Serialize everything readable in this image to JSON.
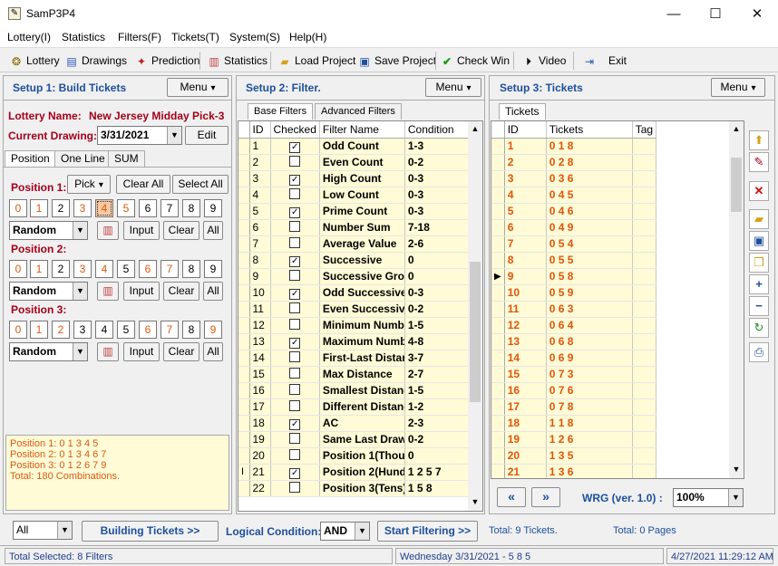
{
  "window": {
    "title": "SamP3P4",
    "minimize": "—",
    "maximize": "☐",
    "close": "✕"
  },
  "menu": [
    "Lottery(I)",
    "Statistics",
    "Filters(F)",
    "Tickets(T)",
    "System(S)",
    "Help(H)"
  ],
  "toolbar": [
    {
      "label": "Lottery",
      "icon": "lottery-icon"
    },
    {
      "label": "Drawings",
      "icon": "drawings-icon"
    },
    {
      "label": "Prediction",
      "icon": "prediction-icon"
    },
    {
      "label": "Statistics",
      "icon": "statistics-icon"
    },
    {
      "label": "Load Project",
      "icon": "folder-icon"
    },
    {
      "label": "Save Project",
      "icon": "save-icon"
    },
    {
      "label": "Check Win",
      "icon": "check-icon"
    },
    {
      "label": "Video",
      "icon": "video-icon"
    },
    {
      "label": "Exit",
      "icon": "exit-icon"
    }
  ],
  "setup1": {
    "title": "Setup 1:  Build  Tickets",
    "menu": "Menu",
    "lottery_label": "Lottery  Name:",
    "lottery_name": "New Jersey Midday Pick-3",
    "drawing_label": "Current Drawing:",
    "drawing_value": "3/31/2021",
    "edit": "Edit",
    "tabs": [
      "Position",
      "One Line",
      "SUM"
    ],
    "pick": "Pick",
    "clear_all": "Clear All",
    "select_all": "Select All",
    "positions": [
      {
        "label": "Position 1:",
        "digits": [
          "0",
          "1",
          "2",
          "3",
          "4",
          "5",
          "6",
          "7",
          "8",
          "9"
        ],
        "mode": "Random"
      },
      {
        "label": "Position 2:",
        "digits": [
          "0",
          "1",
          "2",
          "3",
          "4",
          "5",
          "6",
          "7",
          "8",
          "9"
        ],
        "mode": "Random"
      },
      {
        "label": "Position 3:",
        "digits": [
          "0",
          "1",
          "2",
          "3",
          "4",
          "5",
          "6",
          "7",
          "8",
          "9"
        ],
        "mode": "Random"
      }
    ],
    "input": "Input",
    "clear": "Clear",
    "all": "All",
    "summary": [
      "Position 1:  0 1 3 4 5",
      "Position 2:  0 1 3 4 6 7",
      "Position 3:  0 1 2 6 7 9",
      "Total: 180 Combinations."
    ]
  },
  "setup2": {
    "title": "Setup 2:  Filter.",
    "menu": "Menu",
    "tabs": [
      "Base Filters",
      "Advanced Filters"
    ],
    "columns": [
      "ID",
      "Checked",
      "Filter Name",
      "Condition"
    ],
    "rows": [
      [
        "1",
        true,
        "Odd Count",
        "1-3"
      ],
      [
        "2",
        false,
        "Even Count",
        "0-2"
      ],
      [
        "3",
        true,
        "High Count",
        "0-3"
      ],
      [
        "4",
        false,
        "Low Count",
        "0-3"
      ],
      [
        "5",
        true,
        "Prime Count",
        "0-3"
      ],
      [
        "6",
        false,
        "Number Sum",
        "7-18"
      ],
      [
        "7",
        false,
        "Average Value",
        "2-6"
      ],
      [
        "8",
        true,
        "Successive",
        "0"
      ],
      [
        "9",
        false,
        "Successive Gro",
        "0"
      ],
      [
        "10",
        true,
        "Odd Successive",
        "0-3"
      ],
      [
        "11",
        false,
        "Even Successiv",
        "0-2"
      ],
      [
        "12",
        false,
        "Minimum Numbe",
        "1-5"
      ],
      [
        "13",
        true,
        "Maximum Numbe",
        "4-8"
      ],
      [
        "14",
        false,
        "First-Last Distan",
        "3-7"
      ],
      [
        "15",
        false,
        "Max Distance",
        "2-7"
      ],
      [
        "16",
        false,
        "Smallest Distanc",
        "1-5"
      ],
      [
        "17",
        false,
        "Different Distanc",
        "1-2"
      ],
      [
        "18",
        true,
        "AC",
        "2-3"
      ],
      [
        "19",
        false,
        "Same Last Draw",
        "0-2"
      ],
      [
        "20",
        false,
        "Position 1(Thous",
        "0"
      ],
      [
        "21",
        true,
        "Position 2(Hund",
        "1 2 5 7"
      ],
      [
        "22",
        false,
        "Position 3(Tens)",
        "1 5 8"
      ]
    ]
  },
  "setup3": {
    "title": "Setup 3:  Tickets",
    "menu": "Menu",
    "tab": "Tickets",
    "columns": [
      "ID",
      "Tickets",
      "Tag"
    ],
    "rows": [
      [
        "1",
        "0 1 8"
      ],
      [
        "2",
        "0 2 8"
      ],
      [
        "3",
        "0 3 6"
      ],
      [
        "4",
        "0 4 5"
      ],
      [
        "5",
        "0 4 6"
      ],
      [
        "6",
        "0 4 9"
      ],
      [
        "7",
        "0 5 4"
      ],
      [
        "8",
        "0 5 5"
      ],
      [
        "9",
        "0 5 8"
      ],
      [
        "10",
        "0 5 9"
      ],
      [
        "11",
        "0 6 3"
      ],
      [
        "12",
        "0 6 4"
      ],
      [
        "13",
        "0 6 8"
      ],
      [
        "14",
        "0 6 9"
      ],
      [
        "15",
        "0 7 3"
      ],
      [
        "16",
        "0 7 6"
      ],
      [
        "17",
        "0 7 8"
      ],
      [
        "18",
        "1 1 8"
      ],
      [
        "19",
        "1 2 6"
      ],
      [
        "20",
        "1 3 5"
      ],
      [
        "21",
        "1 3 6"
      ]
    ],
    "wrg": "WRG (ver. 1.0) :",
    "zoom": "100%"
  },
  "bottom": {
    "filter_select": "All",
    "build": "Building  Tickets >>",
    "logical_label": "Logical Condition:",
    "logical_value": "AND",
    "start": "Start Filtering  >>",
    "total_tickets": "Total: 9 Tickets.",
    "total_pages": "Total: 0 Pages"
  },
  "status": {
    "selected": "Total Selected: 8 Filters",
    "draw": "Wednesday 3/31/2021 - 5 8 5",
    "time": "4/27/2021 11:29:12 AM"
  },
  "colors": {
    "accent": "#1d4f9c",
    "orange": "#e0540a",
    "grid_bg": "#fffbd6"
  }
}
